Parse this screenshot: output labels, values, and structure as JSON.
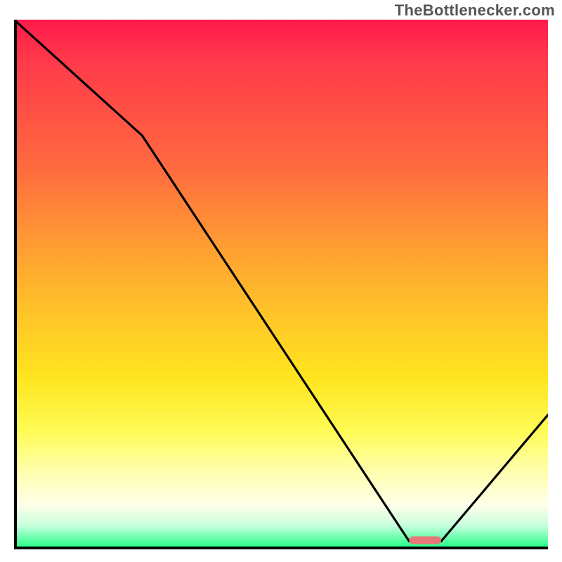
{
  "attribution": "TheBottlenecker.com",
  "chart_data": {
    "type": "line",
    "title": "",
    "xlabel": "",
    "ylabel": "",
    "xlim": [
      0,
      100
    ],
    "ylim": [
      0,
      100
    ],
    "x": [
      0,
      24,
      74,
      80,
      100
    ],
    "values": [
      100,
      78,
      1,
      1,
      25
    ],
    "marker": {
      "x_range": [
        74,
        80
      ],
      "y": 1.2,
      "color": "#e87878"
    },
    "background_gradient": {
      "orientation": "vertical",
      "stops": [
        {
          "pos": 0,
          "color": "#ff1a4b"
        },
        {
          "pos": 28,
          "color": "#ff6a3f"
        },
        {
          "pos": 55,
          "color": "#ffc229"
        },
        {
          "pos": 78,
          "color": "#fffb55"
        },
        {
          "pos": 92,
          "color": "#ffffe8"
        },
        {
          "pos": 100,
          "color": "#2aff8a"
        }
      ]
    }
  }
}
